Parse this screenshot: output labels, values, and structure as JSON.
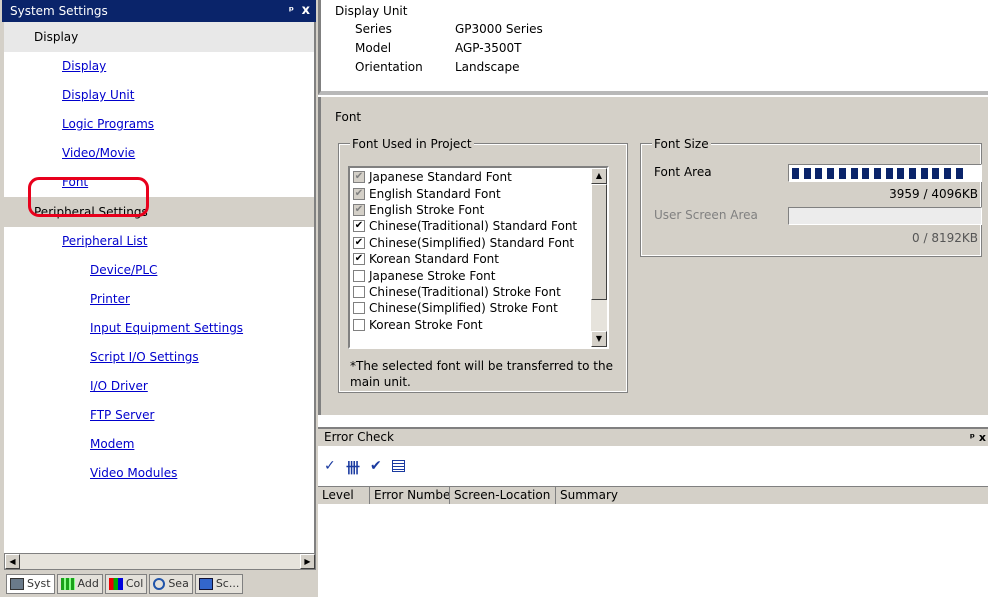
{
  "left_panel": {
    "title": "System Settings",
    "pin_icon": "pin-icon",
    "close_label": "x",
    "sections": [
      {
        "header": "Display",
        "items": [
          "Display",
          "Display Unit",
          "Logic Programs",
          "Video/Movie",
          "Font"
        ]
      },
      {
        "header": "Peripheral Settings",
        "items": [
          "Peripheral List",
          "Device/PLC",
          "Printer",
          "Input Equipment Settings",
          "Script I/O Settings",
          "I/O Driver",
          "FTP Server",
          "Modem",
          "Video Modules"
        ]
      }
    ],
    "highlight_color": "#e8001c",
    "tabs": [
      {
        "label": "Syst",
        "icon": "system-settings-icon"
      },
      {
        "label": "Add",
        "icon": "address-icon"
      },
      {
        "label": "Col",
        "icon": "color-icon"
      },
      {
        "label": "Sea",
        "icon": "search-icon"
      },
      {
        "label": "Sc...",
        "icon": "screen-list-icon"
      }
    ]
  },
  "display_unit": {
    "title": "Display Unit",
    "rows": [
      {
        "label": "Series",
        "value": "GP3000 Series"
      },
      {
        "label": "Model",
        "value": "AGP-3500T"
      },
      {
        "label": "Orientation",
        "value": "Landscape"
      }
    ]
  },
  "font_section": {
    "title": "Font",
    "used_group_title": "Font Used in Project",
    "fonts": [
      {
        "label": "Japanese Standard Font",
        "state": "disabled-checked"
      },
      {
        "label": "English Standard Font",
        "state": "disabled-checked"
      },
      {
        "label": "English Stroke Font",
        "state": "disabled-checked"
      },
      {
        "label": "Chinese(Traditional) Standard Font",
        "state": "checked"
      },
      {
        "label": "Chinese(Simplified) Standard Font",
        "state": "checked"
      },
      {
        "label": "Korean Standard Font",
        "state": "checked"
      },
      {
        "label": "Japanese Stroke Font",
        "state": "unchecked"
      },
      {
        "label": "Chinese(Traditional) Stroke Font",
        "state": "unchecked"
      },
      {
        "label": "Chinese(Simplified) Stroke Font",
        "state": "unchecked"
      },
      {
        "label": "Korean Stroke Font",
        "state": "unchecked"
      }
    ],
    "note_line1": "*The selected font will be transferred to the",
    "note_line2": "main unit.",
    "size_group_title": "Font Size",
    "font_area_label": "Font Area",
    "font_area_value": "3959 / 4096KB",
    "font_area_fill": 0.9666,
    "user_screen_label": "User Screen Area",
    "user_screen_value": "0 / 8192KB",
    "user_screen_fill": 0
  },
  "error_check": {
    "title": "Error Check",
    "pin_label": "ᵖ x",
    "toolbar_icons": [
      "check-all-icon",
      "check-icon",
      "check-edit-icon",
      "list-icon"
    ],
    "columns": [
      "Level",
      "Error Numbe",
      "Screen-Location",
      "Summary"
    ]
  }
}
